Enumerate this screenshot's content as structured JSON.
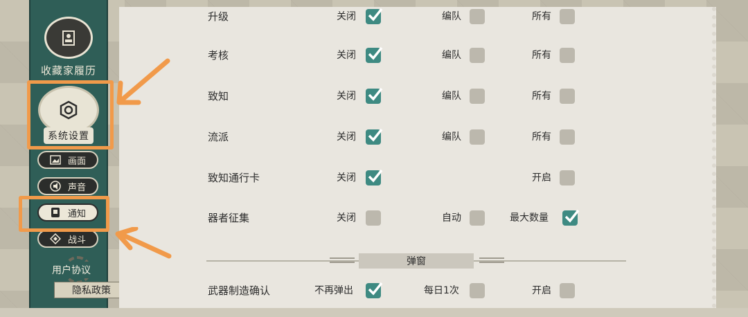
{
  "sidebar": {
    "collection": "收藏家履历",
    "system_settings": "系统设置",
    "items": [
      {
        "label": "画面",
        "icon": "image-icon"
      },
      {
        "label": "声音",
        "icon": "speaker-icon"
      },
      {
        "label": "通知",
        "icon": "notification-icon",
        "active": true
      },
      {
        "label": "战斗",
        "icon": "battle-icon"
      }
    ],
    "user_agreement": "用户协议",
    "privacy_policy": "隐私政策"
  },
  "rows": [
    {
      "title": "升级",
      "opt1": "关闭",
      "opt1_on": true,
      "opt2": "编队",
      "opt2_on": false,
      "opt3": "所有",
      "opt3_on": false
    },
    {
      "title": "考核",
      "opt1": "关闭",
      "opt1_on": true,
      "opt2": "编队",
      "opt2_on": false,
      "opt3": "所有",
      "opt3_on": false
    },
    {
      "title": "致知",
      "opt1": "关闭",
      "opt1_on": true,
      "opt2": "编队",
      "opt2_on": false,
      "opt3": "所有",
      "opt3_on": false
    },
    {
      "title": "流派",
      "opt1": "关闭",
      "opt1_on": true,
      "opt2": "编队",
      "opt2_on": false,
      "opt3": "所有",
      "opt3_on": false
    },
    {
      "title": "致知通行卡",
      "opt1": "关闭",
      "opt1_on": true,
      "opt3": "开启",
      "opt3_on": false
    },
    {
      "title": "器者征集",
      "opt1": "关闭",
      "opt1_on": false,
      "opt2": "自动",
      "opt2_on": false,
      "opt3": "最大数量",
      "opt3_on": true
    }
  ],
  "section_popup": "弹窗",
  "popup_row": {
    "title": "武器制造确认",
    "opt1": "不再弹出",
    "opt1_on": true,
    "opt2": "每日1次",
    "opt2_on": false,
    "opt3": "开启",
    "opt3_on": false
  },
  "colors": {
    "accent": "#3e8a82",
    "highlight": "#f19a4a",
    "sidebar": "#2f5e57"
  }
}
